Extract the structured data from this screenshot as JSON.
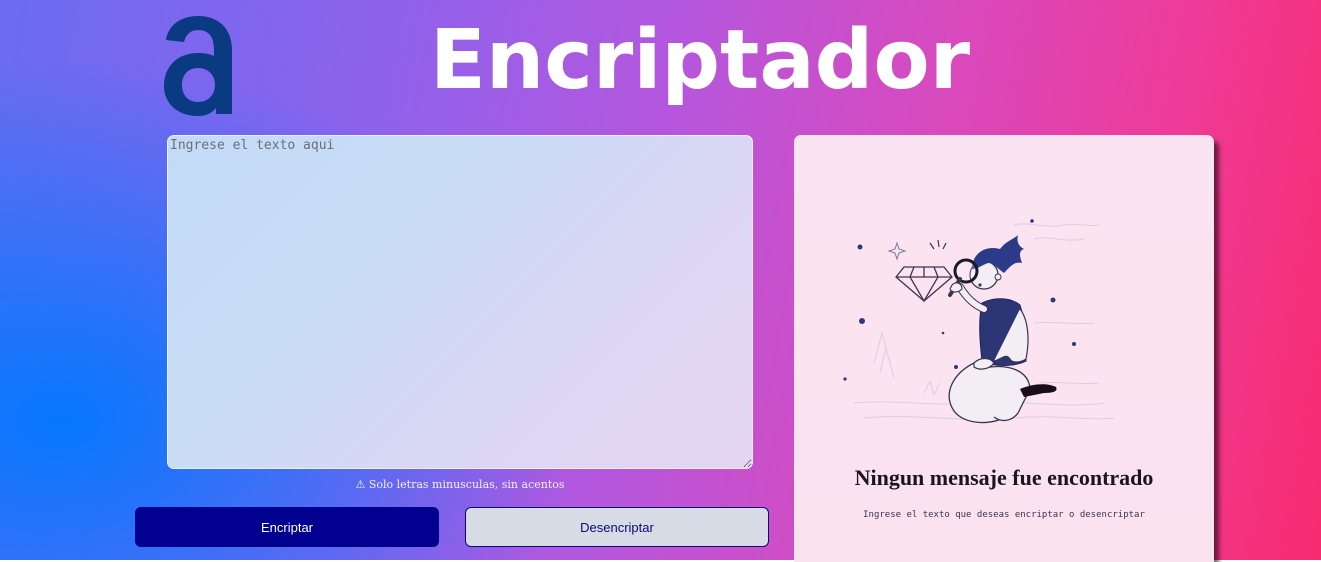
{
  "header": {
    "logo_name": "alura-logo",
    "title": "Encriptador"
  },
  "input": {
    "placeholder": "Ingrese el texto aqui",
    "value": ""
  },
  "warning": {
    "icon": "warning-icon",
    "text": "⚠ Solo letras minusculas, sin acentos"
  },
  "buttons": {
    "encrypt_label": "Encriptar",
    "decrypt_label": "Desencriptar"
  },
  "result_panel": {
    "illustration": "person-with-magnifying-glass-and-diamond",
    "title": "Ningun mensaje fue encontrado",
    "subtitle": "Ingrese el texto que deseas encriptar o desencriptar"
  },
  "colors": {
    "primary_button": "#02008f",
    "secondary_button": "#d6dbe6",
    "logo": "#0a3a82",
    "title_text": "#ffffff"
  }
}
